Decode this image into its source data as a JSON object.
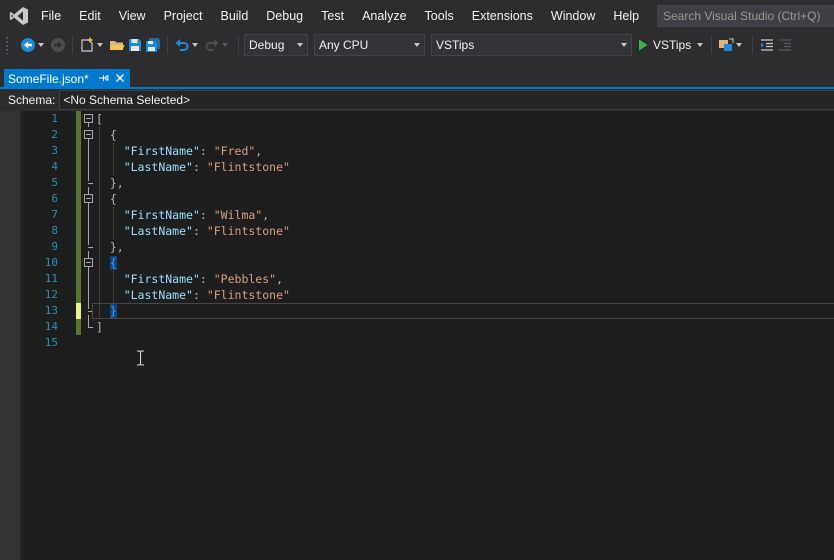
{
  "menu": {
    "items": [
      "File",
      "Edit",
      "View",
      "Project",
      "Build",
      "Debug",
      "Test",
      "Analyze",
      "Tools",
      "Extensions",
      "Window",
      "Help"
    ],
    "search_placeholder": "Search Visual Studio (Ctrl+Q)"
  },
  "toolbar": {
    "configuration": "Debug",
    "platform": "Any CPU",
    "startup_project": "VSTips",
    "start_label": "VSTips"
  },
  "tab": {
    "title": "SomeFile.json*"
  },
  "schema": {
    "label": "Schema:",
    "value": "<No Schema Selected>"
  },
  "editor": {
    "line_numbers": [
      "1",
      "2",
      "3",
      "4",
      "5",
      "6",
      "7",
      "8",
      "9",
      "10",
      "11",
      "12",
      "13",
      "14",
      "15"
    ],
    "lines": [
      "[",
      "  {",
      "    \"FirstName\": \"Fred\",",
      "    \"LastName\": \"Flintstone\"",
      "  },",
      "  {",
      "    \"FirstName\": \"Wilma\",",
      "    \"LastName\": \"Flintstone\"",
      "  },",
      "  {",
      "    \"FirstName\": \"Pebbles\",",
      "    \"LastName\": \"Flintstone\"",
      "  }",
      "]",
      ""
    ]
  },
  "colors": {
    "accent": "#007acc",
    "line_number": "#2b91af",
    "json_key": "#9cdcfe",
    "json_string": "#d69d85",
    "saved_change": "#577430",
    "unsaved_change": "#efef91"
  }
}
